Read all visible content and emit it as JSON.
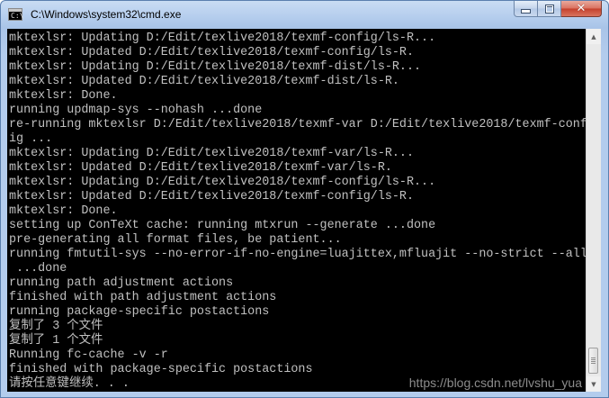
{
  "window": {
    "title": "C:\\Windows\\system32\\cmd.exe",
    "icon_text": "C:\\",
    "controls": {
      "minimize_icon": "minimize-icon",
      "maximize_icon": "maximize-icon",
      "close_icon": "close-icon",
      "close_glyph": "✕"
    }
  },
  "console": {
    "background": "#000000",
    "foreground": "#c0c0c0",
    "lines": [
      "mktexlsr: Updating D:/Edit/texlive2018/texmf-config/ls-R...",
      "mktexlsr: Updated D:/Edit/texlive2018/texmf-config/ls-R.",
      "mktexlsr: Updating D:/Edit/texlive2018/texmf-dist/ls-R...",
      "mktexlsr: Updated D:/Edit/texlive2018/texmf-dist/ls-R.",
      "mktexlsr: Done.",
      "running updmap-sys --nohash ...done",
      "re-running mktexlsr D:/Edit/texlive2018/texmf-var D:/Edit/texlive2018/texmf-conf",
      "ig ...",
      "mktexlsr: Updating D:/Edit/texlive2018/texmf-var/ls-R...",
      "mktexlsr: Updated D:/Edit/texlive2018/texmf-var/ls-R.",
      "mktexlsr: Updating D:/Edit/texlive2018/texmf-config/ls-R...",
      "mktexlsr: Updated D:/Edit/texlive2018/texmf-config/ls-R.",
      "mktexlsr: Done.",
      "setting up ConTeXt cache: running mtxrun --generate ...done",
      "pre-generating all format files, be patient...",
      "running fmtutil-sys --no-error-if-no-engine=luajittex,mfluajit --no-strict --all",
      " ...done",
      "running path adjustment actions",
      "finished with path adjustment actions",
      "running package-specific postactions",
      "复制了 3 个文件",
      "复制了 1 个文件",
      "Running fc-cache -v -r",
      "finished with package-specific postactions",
      "请按任意键继续. . ."
    ],
    "watermark": "https://blog.csdn.net/lvshu_yua"
  },
  "scrollbar": {
    "up_glyph": "▲",
    "down_glyph": "▼",
    "position": 1.0
  }
}
